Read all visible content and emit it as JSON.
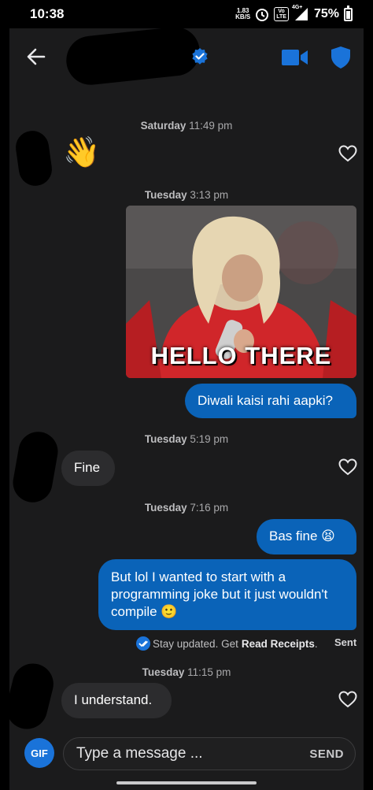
{
  "status_bar": {
    "time": "10:38",
    "net_speed_value": "1.83",
    "net_speed_unit": "KB/S",
    "volte_top": "Vo",
    "volte_bottom": "LTE",
    "network": "4G+",
    "battery": "75%"
  },
  "header": {
    "back_icon": "arrow-left-icon",
    "verified_icon": "verified-badge-icon",
    "video_icon": "video-call-icon",
    "shield_icon": "shield-icon"
  },
  "colors": {
    "accent": "#1a73d9",
    "outgoing_bubble": "#0a63b8",
    "incoming_bubble": "#2c2c2e",
    "background": "#1b1b1c"
  },
  "messages": [
    {
      "timestamp_day": "Saturday",
      "timestamp_time": "11:49 pm",
      "direction": "in",
      "emoji": "👋"
    },
    {
      "timestamp_day": "Tuesday",
      "timestamp_time": "3:13 pm",
      "direction": "out",
      "gif_caption": "HELLO THERE"
    },
    {
      "direction": "out",
      "text": "Diwali kaisi rahi aapki?"
    },
    {
      "timestamp_day": "Tuesday",
      "timestamp_time": "5:19 pm",
      "direction": "in",
      "text": "Fine"
    },
    {
      "timestamp_day": "Tuesday",
      "timestamp_time": "7:16 pm",
      "direction": "out",
      "text": "Bas fine 😫"
    },
    {
      "direction": "out",
      "text": "But lol I wanted to start with a programming joke but it just wouldn't compile 🙂"
    },
    {
      "timestamp_day": "Tuesday",
      "timestamp_time": "11:15 pm",
      "direction": "in",
      "text": "I understand."
    }
  ],
  "read_receipts": {
    "prefix": "Stay updated. Get",
    "link": "Read Receipts",
    "suffix": ".",
    "status": "Sent"
  },
  "composer": {
    "gif_label": "GIF",
    "placeholder": "Type a message ...",
    "send_label": "SEND"
  }
}
